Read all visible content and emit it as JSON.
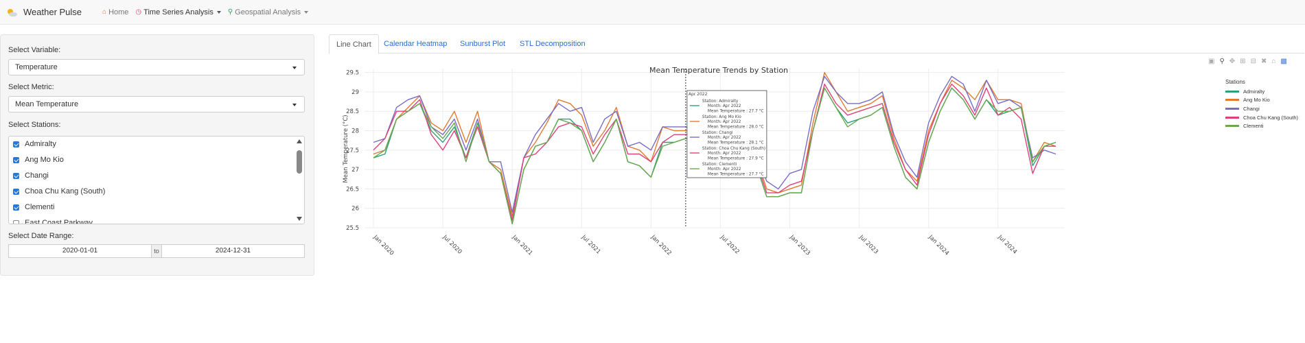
{
  "app": {
    "title": "Weather Pulse"
  },
  "nav": [
    {
      "label": "Home",
      "icon": "home-icon"
    },
    {
      "label": "Time Series Analysis",
      "icon": "clock-icon"
    },
    {
      "label": "Geospatial Analysis",
      "icon": "map-pin-icon"
    }
  ],
  "sidebar": {
    "variable_label": "Select Variable:",
    "variable_value": "Temperature",
    "metric_label": "Select Metric:",
    "metric_value": "Mean Temperature",
    "stations_label": "Select Stations:",
    "stations": [
      {
        "name": "Admiralty",
        "checked": true
      },
      {
        "name": "Ang Mo Kio",
        "checked": true
      },
      {
        "name": "Changi",
        "checked": true
      },
      {
        "name": "Choa Chu Kang (South)",
        "checked": true
      },
      {
        "name": "Clementi",
        "checked": true
      },
      {
        "name": "East Coast Parkway",
        "checked": false
      }
    ],
    "date_label": "Select Date Range:",
    "date_start": "2020-01-01",
    "date_sep": "to",
    "date_end": "2024-12-31"
  },
  "tabs": [
    {
      "label": "Line Chart",
      "active": true
    },
    {
      "label": "Calendar Heatmap",
      "active": false
    },
    {
      "label": "Sunburst Plot",
      "active": false
    },
    {
      "label": "STL Decomposition",
      "active": false
    }
  ],
  "chart_data": {
    "type": "line",
    "title": "Mean Temperature Trends by Station",
    "xlabel": "",
    "ylabel": "Mean Temperature (°C)",
    "ylim": [
      25.5,
      29.6
    ],
    "yticks": [
      "25.5",
      "26",
      "26.5",
      "27",
      "27.5",
      "28",
      "28.5",
      "29",
      "29.5"
    ],
    "xticks": [
      "Jan 2020",
      "Jul 2020",
      "Jan 2021",
      "Jul 2021",
      "Jan 2022",
      "Jul 2022",
      "Jan 2023",
      "Jul 2023",
      "Jan 2024",
      "Jul 2024"
    ],
    "x": [
      "2020-01",
      "2020-02",
      "2020-03",
      "2020-04",
      "2020-05",
      "2020-06",
      "2020-07",
      "2020-08",
      "2020-09",
      "2020-10",
      "2020-11",
      "2020-12",
      "2021-01",
      "2021-02",
      "2021-03",
      "2021-04",
      "2021-05",
      "2021-06",
      "2021-07",
      "2021-08",
      "2021-09",
      "2021-10",
      "2021-11",
      "2021-12",
      "2022-01",
      "2022-02",
      "2022-03",
      "2022-04",
      "2022-05",
      "2022-06",
      "2022-07",
      "2022-08",
      "2022-09",
      "2022-10",
      "2022-11",
      "2022-12",
      "2023-01",
      "2023-02",
      "2023-03",
      "2023-04",
      "2023-05",
      "2023-06",
      "2023-07",
      "2023-08",
      "2023-09",
      "2023-10",
      "2023-11",
      "2023-12",
      "2024-01",
      "2024-02",
      "2024-03",
      "2024-04",
      "2024-05",
      "2024-06",
      "2024-07",
      "2024-08",
      "2024-09",
      "2024-10",
      "2024-11",
      "2024-12"
    ],
    "legend_title": "Stations",
    "legend_position": "right",
    "grid": true,
    "series": [
      {
        "name": "Admiralty",
        "color": "#2ca07a",
        "values": [
          27.3,
          27.4,
          28.3,
          28.5,
          28.7,
          28.0,
          27.7,
          28.1,
          27.3,
          28.2,
          27.2,
          26.9,
          25.6,
          27.0,
          27.6,
          27.7,
          28.3,
          28.3,
          28.0,
          27.2,
          27.7,
          28.3,
          27.2,
          27.1,
          26.8,
          27.7,
          27.7,
          27.8,
          27.8,
          27.8,
          27.6,
          27.3,
          27.4,
          27.2,
          26.3,
          26.3,
          26.4,
          26.4,
          28.0,
          29.1,
          28.6,
          28.2,
          28.3,
          28.4,
          28.6,
          27.6,
          26.8,
          26.5,
          27.7,
          28.5,
          29.1,
          28.8,
          28.3,
          28.8,
          28.4,
          28.5,
          28.6,
          27.1,
          27.6,
          27.7
        ]
      },
      {
        "name": "Ang Mo Kio",
        "color": "#e07a30",
        "values": [
          27.4,
          27.5,
          28.3,
          28.6,
          28.9,
          28.2,
          28.0,
          28.5,
          27.7,
          28.5,
          27.2,
          27.0,
          25.8,
          27.3,
          27.7,
          28.2,
          28.8,
          28.7,
          28.4,
          27.6,
          28.0,
          28.6,
          27.6,
          27.5,
          27.2,
          28.1,
          28.0,
          28.0,
          28.0,
          28.0,
          27.9,
          27.6,
          27.7,
          27.4,
          26.5,
          26.4,
          26.5,
          26.6,
          28.2,
          29.5,
          29.0,
          28.5,
          28.6,
          28.7,
          28.9,
          27.8,
          27.0,
          26.7,
          28.0,
          28.7,
          29.3,
          29.1,
          28.8,
          29.3,
          28.8,
          28.8,
          28.7,
          27.2,
          27.7,
          27.6
        ]
      },
      {
        "name": "Changi",
        "color": "#7a6bc4",
        "values": [
          27.7,
          27.8,
          28.6,
          28.8,
          28.9,
          28.1,
          27.9,
          28.3,
          27.5,
          28.3,
          27.2,
          27.2,
          25.9,
          27.3,
          27.9,
          28.3,
          28.7,
          28.5,
          28.6,
          27.7,
          28.3,
          28.5,
          27.6,
          27.7,
          27.5,
          28.1,
          28.1,
          28.1,
          28.0,
          28.0,
          28.0,
          27.8,
          27.9,
          27.5,
          26.7,
          26.5,
          26.9,
          27.0,
          28.5,
          29.4,
          29.0,
          28.7,
          28.7,
          28.8,
          29.0,
          27.9,
          27.2,
          26.8,
          28.2,
          28.9,
          29.4,
          29.2,
          28.5,
          29.3,
          28.7,
          28.8,
          28.6,
          27.3,
          27.5,
          27.4
        ]
      },
      {
        "name": "Choa Chu Kang (South)",
        "color": "#e0407a",
        "values": [
          27.5,
          27.8,
          28.5,
          28.5,
          28.8,
          27.9,
          27.5,
          28.0,
          27.3,
          28.1,
          27.2,
          26.9,
          25.7,
          27.3,
          27.4,
          27.7,
          28.1,
          28.2,
          28.1,
          27.4,
          27.9,
          28.3,
          27.4,
          27.4,
          27.2,
          27.7,
          27.9,
          27.9,
          27.9,
          27.9,
          27.7,
          27.4,
          27.5,
          27.3,
          26.4,
          26.4,
          26.6,
          26.7,
          28.0,
          29.2,
          28.7,
          28.4,
          28.5,
          28.6,
          28.7,
          27.7,
          27.0,
          26.6,
          27.9,
          28.7,
          29.2,
          28.9,
          28.4,
          29.1,
          28.4,
          28.6,
          28.3,
          26.9,
          27.6,
          27.6
        ]
      },
      {
        "name": "Clementi",
        "color": "#6aa84f",
        "values": [
          27.3,
          27.5,
          28.3,
          28.5,
          28.7,
          28.1,
          27.8,
          28.2,
          27.2,
          28.2,
          27.2,
          26.9,
          25.6,
          27.0,
          27.6,
          27.7,
          28.3,
          28.2,
          28.0,
          27.2,
          27.7,
          28.3,
          27.2,
          27.1,
          26.8,
          27.6,
          27.7,
          27.8,
          27.8,
          27.8,
          27.6,
          27.3,
          27.4,
          27.2,
          26.3,
          26.3,
          26.4,
          26.4,
          28.0,
          29.1,
          28.6,
          28.1,
          28.3,
          28.4,
          28.6,
          27.6,
          26.8,
          26.5,
          27.7,
          28.5,
          29.1,
          28.8,
          28.3,
          28.8,
          28.5,
          28.5,
          28.6,
          27.2,
          27.6,
          27.7
        ]
      }
    ],
    "hover": {
      "header": "Apr 2022",
      "entries": [
        {
          "station_line": "Station: Admiralty",
          "month_line": "Month: Apr 2022",
          "value_line": "Mean Temperature : 27.7 °C"
        },
        {
          "station_line": "Station: Ang Mo Kio",
          "month_line": "Month: Apr 2022",
          "value_line": "Mean Temperature : 28.0 °C"
        },
        {
          "station_line": "Station: Changi",
          "month_line": "Month: Apr 2022",
          "value_line": "Mean Temperature : 28.1 °C"
        },
        {
          "station_line": "Station: Choa Chu Kang (South)",
          "month_line": "Month: Apr 2022",
          "value_line": "Mean Temperature : 27.9 °C"
        },
        {
          "station_line": "Station: Clementi",
          "month_line": "Month: Apr 2022",
          "value_line": "Mean Temperature : 27.7 °C"
        }
      ]
    }
  }
}
